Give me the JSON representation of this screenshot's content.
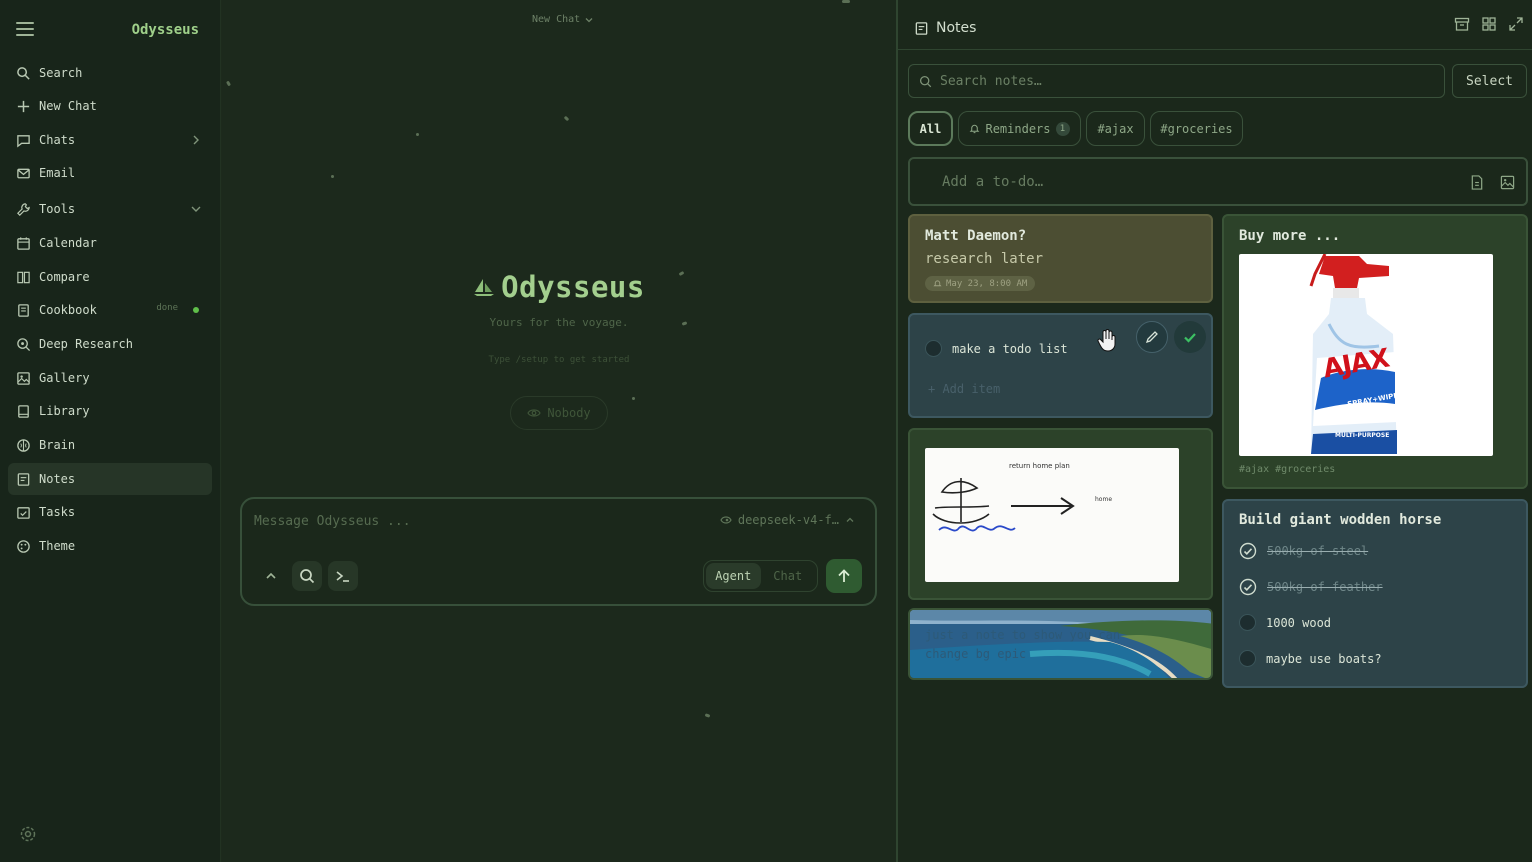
{
  "sidebar": {
    "brand": "Odysseus",
    "items": [
      {
        "label": "Search",
        "icon": "search-icon"
      },
      {
        "label": "New Chat",
        "icon": "plus-icon"
      },
      {
        "label": "Chats",
        "icon": "chat-bubble-icon"
      },
      {
        "label": "Email",
        "icon": "mail-icon"
      },
      {
        "label": "Tools",
        "icon": "wrench-icon"
      },
      {
        "label": "Calendar",
        "icon": "calendar-icon"
      },
      {
        "label": "Compare",
        "icon": "columns-icon"
      },
      {
        "label": "Cookbook",
        "icon": "book-icon",
        "badge": "done"
      },
      {
        "label": "Deep Research",
        "icon": "magnifier-plus-icon"
      },
      {
        "label": "Gallery",
        "icon": "image-icon"
      },
      {
        "label": "Library",
        "icon": "library-icon"
      },
      {
        "label": "Brain",
        "icon": "brain-icon"
      },
      {
        "label": "Notes",
        "icon": "note-icon"
      },
      {
        "label": "Tasks",
        "icon": "tasks-icon"
      },
      {
        "label": "Theme",
        "icon": "palette-icon"
      }
    ],
    "active_item": "Notes"
  },
  "chat": {
    "selector_label": "New Chat",
    "hero_title": "Odysseus",
    "tagline": "Yours for the voyage.",
    "hint": "Type /setup to get started",
    "visibility_label": "Nobody",
    "composer": {
      "placeholder": "Message Odysseus ...",
      "model": "deepseek-v4-f…",
      "mode_agent": "Agent",
      "mode_chat": "Chat",
      "active_mode": "Agent"
    }
  },
  "notes": {
    "title": "Notes",
    "search_placeholder": "Search notes…",
    "select_label": "Select",
    "filters": [
      {
        "label": "All",
        "active": true
      },
      {
        "label": "Reminders",
        "count": "1"
      },
      {
        "label": "#ajax"
      },
      {
        "label": "#groceries"
      }
    ],
    "todo_placeholder": "Add a to-do…",
    "cards": {
      "matt": {
        "title": "Matt Daemon?",
        "body": "research later",
        "reminder": "May 23, 8:00 AM"
      },
      "todo": {
        "item": "make a todo list",
        "add_item": "+ Add item"
      },
      "sketch": {
        "caption": "return home plan",
        "label_home": "home"
      },
      "bg": {
        "text": "just a note to show you can change bg epic"
      },
      "ajax": {
        "title": "Buy more ...",
        "tags": "#ajax #groceries",
        "product_brand": "AJAX",
        "product_sub": "SPRAY+WIPE",
        "product_desc": "MULTI-PURPOSE"
      },
      "horse": {
        "title": "Build giant wodden horse",
        "items": [
          {
            "label": "500kg of steel",
            "done": true
          },
          {
            "label": "500kg of feather",
            "done": true
          },
          {
            "label": "1000 wood",
            "done": false
          },
          {
            "label": "maybe use boats?",
            "done": false
          }
        ]
      }
    }
  },
  "colors": {
    "accent": "#9fd08a",
    "background": "#1d2a1c",
    "send_button": "#2f5b31",
    "check_green": "#2f9e4b"
  }
}
